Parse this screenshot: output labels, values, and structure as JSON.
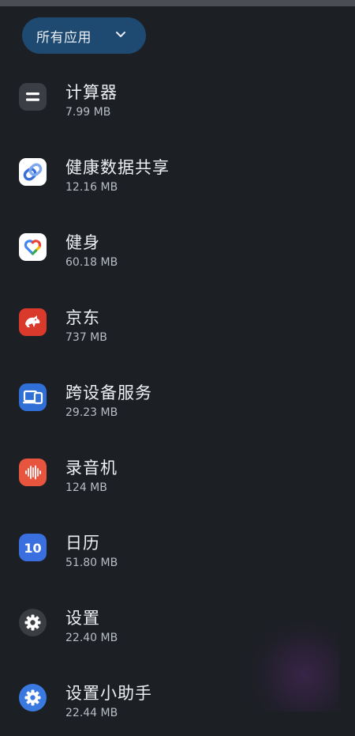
{
  "filter": {
    "label": "所有应用",
    "icon": "chevron-down-icon"
  },
  "apps": [
    {
      "name": "计算器",
      "size": "7.99 MB",
      "icon": "calculator-icon"
    },
    {
      "name": "健康数据共享",
      "size": "12.16 MB",
      "icon": "health-connect-icon"
    },
    {
      "name": "健身",
      "size": "60.18 MB",
      "icon": "fit-heart-icon"
    },
    {
      "name": "京东",
      "size": "737 MB",
      "icon": "jd-dog-icon"
    },
    {
      "name": "跨设备服务",
      "size": "29.23 MB",
      "icon": "cross-device-icon"
    },
    {
      "name": "录音机",
      "size": "124 MB",
      "icon": "recorder-icon"
    },
    {
      "name": "日历",
      "size": "51.80 MB",
      "icon": "calendar-icon",
      "icon_text": "10"
    },
    {
      "name": "设置",
      "size": "22.40 MB",
      "icon": "settings-gear-icon"
    },
    {
      "name": "设置小助手",
      "size": "22.44 MB",
      "icon": "settings-helper-icon"
    }
  ],
  "colors": {
    "background": "#1c1f24",
    "chip": "#1e4a72",
    "calculator": "#3b3e44",
    "jd": "#d93a2b",
    "cross_device": "#2f6fd6",
    "recorder": "#e8553e",
    "calendar": "#3a6fe0",
    "settings": "#3a3d42",
    "settings_helper": "#3a7ae0"
  }
}
